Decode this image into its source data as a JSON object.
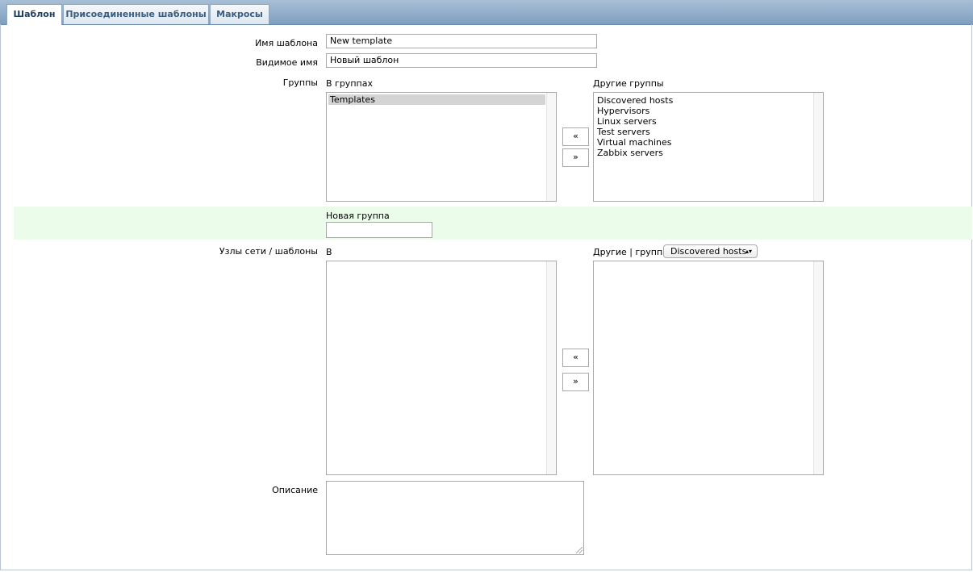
{
  "tabs": [
    {
      "label": "Шаблон",
      "active": true
    },
    {
      "label": "Присоединенные шаблоны",
      "active": false
    },
    {
      "label": "Макросы",
      "active": false
    }
  ],
  "form": {
    "template_name_label": "Имя шаблона",
    "template_name_value": "New template",
    "visible_name_label": "Видимое имя",
    "visible_name_value": "Новый шаблон",
    "groups_label": "Группы",
    "in_groups_label": "В группах",
    "in_groups": [
      "Templates"
    ],
    "other_groups_label": "Другие группы",
    "other_groups": [
      "Discovered hosts",
      "Hypervisors",
      "Linux servers",
      "Test servers",
      "Virtual machines",
      "Zabbix servers"
    ],
    "move_left": "«",
    "move_right": "»",
    "new_group_label": "Новая группа",
    "new_group_value": "",
    "hosts_label": "Узлы сети / шаблоны",
    "hosts_in_label": "В",
    "hosts_other_label": "Другие | группа",
    "hosts_group_selected": "Discovered hosts",
    "description_label": "Описание",
    "description_value": ""
  },
  "colors": {
    "accent": "#3a5d82",
    "highlight_row": "#ecfcea",
    "selected_option": "#d4d4d4"
  }
}
